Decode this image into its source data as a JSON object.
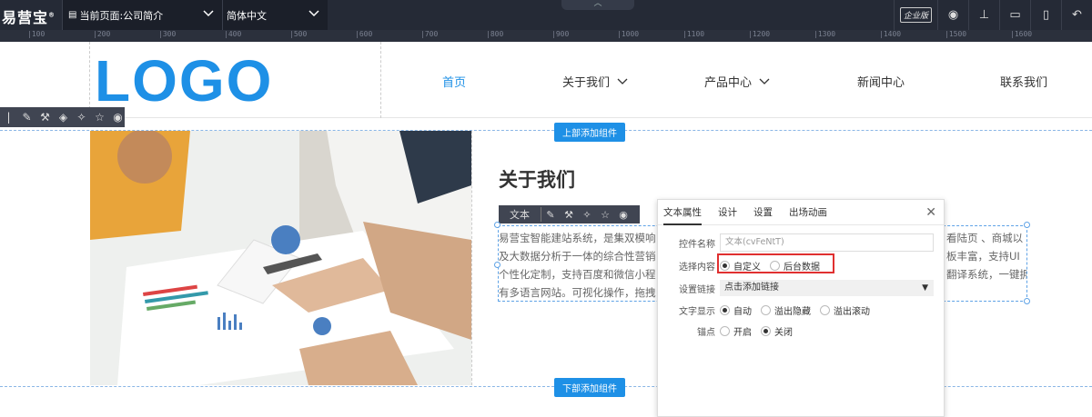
{
  "topbar": {
    "brand": "易营宝",
    "brand_mark": "®",
    "current_page": "当前页面:公司简介",
    "language": "简体中文",
    "enterprise_badge": "企业版"
  },
  "ruler": {
    "ticks": [
      "|100",
      "|200",
      "|300",
      "|400",
      "|500",
      "|600",
      "|700",
      "|800",
      "|900",
      "|1000",
      "|1100",
      "|1200",
      "|1300",
      "|1400",
      "|1500",
      "|1600"
    ]
  },
  "header": {
    "logo": "LOGO",
    "nav": [
      "首页",
      "关于我们",
      "产品中心",
      "新闻中心",
      "联系我们"
    ]
  },
  "editor": {
    "add_top": "上部添加组件",
    "add_bottom": "下部添加组件",
    "text_tool_label": "文本"
  },
  "content": {
    "title": "关于我们",
    "lines": [
      "易营宝智能建站系统，是集双模响",
      "及大数据分析于一体的综合性营销",
      "个性化定制，支持百度和微信小程",
      "有多语言网站。可视化操作，拖拽"
    ],
    "right_fragments": [
      "看陆页 、商城以",
      "板丰富，支持UI",
      "翻译系统，一键拥"
    ]
  },
  "panel": {
    "tabs": [
      "文本属性",
      "设计",
      "设置",
      "出场动画"
    ],
    "fields": {
      "name_label": "控件名称",
      "name_placeholder": "文本(cvFeNtT)",
      "content_label": "选择内容",
      "content_options": [
        "自定义",
        "后台数据"
      ],
      "link_label": "设置链接",
      "link_value": "点击添加链接",
      "display_label": "文字显示",
      "display_options": [
        "自动",
        "溢出隐藏",
        "溢出滚动"
      ],
      "anchor_label": "锚点",
      "anchor_options": [
        "开启",
        "关闭"
      ]
    }
  },
  "colors": {
    "accent": "#1e90e6",
    "topbar": "#252a36",
    "highlight": "#e03030"
  }
}
